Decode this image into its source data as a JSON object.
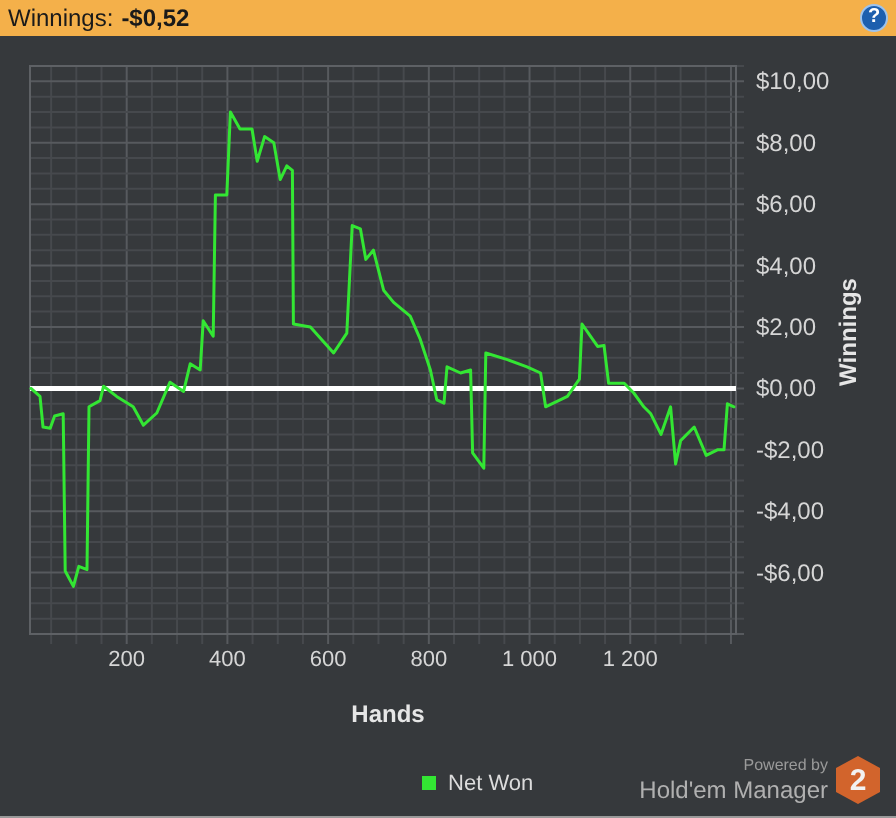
{
  "header": {
    "label": "Winnings:",
    "value": "-$0,52",
    "help": "?"
  },
  "chart": {
    "chart_data": {
      "type": "line",
      "xlabel": "Hands",
      "ylabel": "Winnings",
      "xlim": [
        8,
        1410
      ],
      "ylim": [
        -8,
        10.5
      ],
      "xticks": [
        200,
        400,
        600,
        800,
        {
          "value": 1000,
          "label": "1 000"
        },
        {
          "value": 1200,
          "label": "1 200"
        }
      ],
      "yticks": [
        {
          "value": 10,
          "label": "$10,00"
        },
        {
          "value": 8,
          "label": "$8,00"
        },
        {
          "value": 6,
          "label": "$6,00"
        },
        {
          "value": 4,
          "label": "$4,00"
        },
        {
          "value": 2,
          "label": "$2,00"
        },
        {
          "value": 0,
          "label": "$0,00"
        },
        {
          "value": -2,
          "label": "-$2,00"
        },
        {
          "value": -4,
          "label": "-$4,00"
        },
        {
          "value": -6,
          "label": "-$6,00"
        }
      ],
      "x": [
        10,
        28,
        34,
        48,
        57,
        74,
        78,
        94,
        105,
        121,
        125,
        147,
        154,
        180,
        213,
        233,
        260,
        286,
        313,
        326,
        346,
        352,
        372,
        376,
        399,
        406,
        425,
        449,
        459,
        474,
        492,
        505,
        518,
        529,
        531,
        565,
        611,
        637,
        648,
        664,
        675,
        690,
        710,
        730,
        763,
        783,
        803,
        816,
        830,
        836,
        863,
        883,
        887,
        909,
        913,
        956,
        995,
        1022,
        1032,
        1075,
        1099,
        1104,
        1121,
        1135,
        1148,
        1157,
        1188,
        1207,
        1227,
        1241,
        1261,
        1280,
        1290,
        1300,
        1327,
        1351,
        1373,
        1386,
        1393,
        1406
      ],
      "series": [
        {
          "name": "Net Won",
          "color": "#33e633",
          "values": [
            0,
            -0.26,
            -1.26,
            -1.3,
            -0.9,
            -0.83,
            -5.95,
            -6.45,
            -5.8,
            -5.9,
            -0.6,
            -0.4,
            0.07,
            -0.26,
            -0.6,
            -1.2,
            -0.8,
            0.2,
            -0.1,
            0.8,
            0.6,
            2.2,
            1.7,
            6.3,
            6.3,
            9.0,
            8.45,
            8.45,
            7.4,
            8.2,
            8.0,
            6.8,
            7.25,
            7.1,
            2.1,
            2.0,
            1.15,
            1.8,
            5.3,
            5.2,
            4.2,
            4.5,
            3.2,
            2.8,
            2.35,
            1.6,
            0.6,
            -0.37,
            -0.48,
            0.7,
            0.5,
            0.6,
            -2.1,
            -2.6,
            1.15,
            0.94,
            0.7,
            0.5,
            -0.6,
            -0.26,
            0.3,
            2.1,
            1.7,
            1.37,
            1.4,
            0.17,
            0.17,
            -0.15,
            -0.6,
            -0.83,
            -1.5,
            -0.6,
            -2.46,
            -1.7,
            -1.26,
            -2.18,
            -2.0,
            -2.0,
            -0.5,
            -0.6
          ]
        }
      ],
      "grid": true,
      "ref_lines": [
        {
          "axis": "y",
          "value": 0
        }
      ]
    }
  },
  "footer": {
    "powered_by": "Powered by",
    "product": "Hold'em Manager",
    "badge": "2"
  }
}
